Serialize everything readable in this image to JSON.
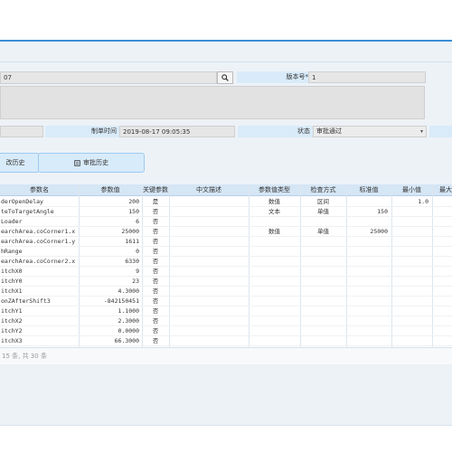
{
  "form": {
    "code_value": "07",
    "version_label": "版本号*",
    "version_value": "1",
    "created_label": "制单时间",
    "created_value": "2019-08-17 09:05:35",
    "status_label": "状态",
    "status_value": "审批通过"
  },
  "tabs": [
    {
      "label": "改历史"
    },
    {
      "label": "审批历史"
    }
  ],
  "table": {
    "columns": [
      "参数名",
      "参数值",
      "关键参数",
      "中文描述",
      "参数值类型",
      "检查方式",
      "标准值",
      "最小值",
      "最大"
    ],
    "rows": [
      {
        "name": "derOpenDelay",
        "value": "200",
        "key": "是",
        "desc": "",
        "type": "数值",
        "check": "区间",
        "std": "",
        "min": "1.0"
      },
      {
        "name": "teToTargetAngle",
        "value": "150",
        "key": "否",
        "desc": "",
        "type": "文本",
        "check": "单值",
        "std": "150",
        "min": ""
      },
      {
        "name": " Loader",
        "value": "6",
        "key": "否",
        "desc": "",
        "type": "",
        "check": "",
        "std": "",
        "min": ""
      },
      {
        "name": "earchArea.coCorner1.x",
        "value": "25000",
        "key": "否",
        "desc": "",
        "type": "数值",
        "check": "单值",
        "std": "25000",
        "min": ""
      },
      {
        "name": "earchArea.coCorner1.y",
        "value": "1611",
        "key": "否",
        "desc": "",
        "type": "",
        "check": "",
        "std": "",
        "min": ""
      },
      {
        "name": "hRange",
        "value": "0",
        "key": "否",
        "desc": "",
        "type": "",
        "check": "",
        "std": "",
        "min": ""
      },
      {
        "name": "earchArea.coCorner2.x",
        "value": "6330",
        "key": "否",
        "desc": "",
        "type": "",
        "check": "",
        "std": "",
        "min": ""
      },
      {
        "name": "itchX0",
        "value": "9",
        "key": "否",
        "desc": "",
        "type": "",
        "check": "",
        "std": "",
        "min": ""
      },
      {
        "name": "itchY0",
        "value": "23",
        "key": "否",
        "desc": "",
        "type": "",
        "check": "",
        "std": "",
        "min": ""
      },
      {
        "name": "itchX1",
        "value": "4.3000",
        "key": "否",
        "desc": "",
        "type": "",
        "check": "",
        "std": "",
        "min": ""
      },
      {
        "name": "onZAfterShift3",
        "value": "-842150451",
        "key": "否",
        "desc": "",
        "type": "",
        "check": "",
        "std": "",
        "min": ""
      },
      {
        "name": "itchY1",
        "value": "1.1000",
        "key": "否",
        "desc": "",
        "type": "",
        "check": "",
        "std": "",
        "min": ""
      },
      {
        "name": "itchX2",
        "value": "2.3000",
        "key": "否",
        "desc": "",
        "type": "",
        "check": "",
        "std": "",
        "min": ""
      },
      {
        "name": "itchY2",
        "value": "0.0000",
        "key": "否",
        "desc": "",
        "type": "",
        "check": "",
        "std": "",
        "min": ""
      },
      {
        "name": "itchX3",
        "value": "66.3000",
        "key": "否",
        "desc": "",
        "type": "",
        "check": "",
        "std": "",
        "min": ""
      }
    ]
  },
  "pager": {
    "text": "15  条, 共 30 条"
  },
  "colors": {
    "accent": "#3c8dd6",
    "label_bg": "#d9ebf9",
    "header_bg": "#d5e6f5",
    "panel_bg": "#edf2f7"
  },
  "icons": {
    "search": "search-icon",
    "edit_history": "edit-icon",
    "audit_history": "audit-icon",
    "dropdown": "chevron-down-icon"
  }
}
